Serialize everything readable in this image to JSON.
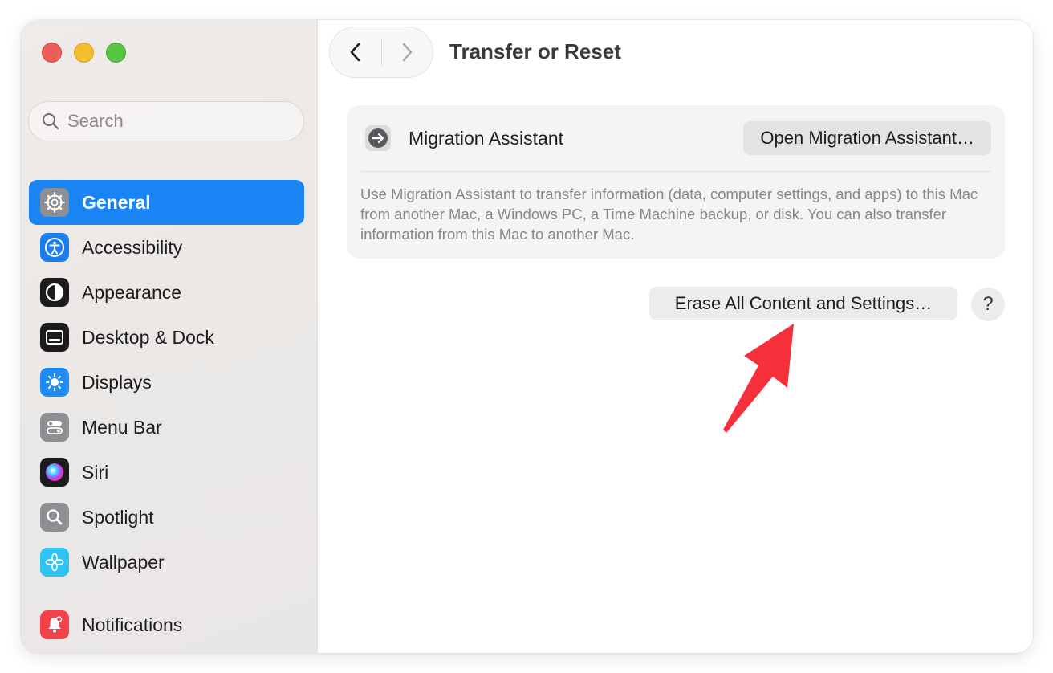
{
  "window": {
    "title": "Transfer or Reset"
  },
  "search": {
    "placeholder": "Search"
  },
  "sidebar": {
    "items": [
      {
        "label": "General",
        "icon": "gear-icon",
        "active": true
      },
      {
        "label": "Accessibility",
        "icon": "accessibility-icon"
      },
      {
        "label": "Appearance",
        "icon": "appearance-icon"
      },
      {
        "label": "Desktop & Dock",
        "icon": "dock-icon"
      },
      {
        "label": "Displays",
        "icon": "sun-icon"
      },
      {
        "label": "Menu Bar",
        "icon": "menu-bar-icon"
      },
      {
        "label": "Siri",
        "icon": "siri-icon"
      },
      {
        "label": "Spotlight",
        "icon": "magnifier-icon"
      },
      {
        "label": "Wallpaper",
        "icon": "flower-icon"
      },
      {
        "label": "Notifications",
        "icon": "bell-icon"
      }
    ]
  },
  "migration": {
    "label": "Migration Assistant",
    "button": "Open Migration Assistant…",
    "description": "Use Migration Assistant to transfer information (data, computer settings, and apps) to this Mac from another Mac, a Windows PC, a Time Machine backup, or disk. You can also transfer information from this Mac to another Mac."
  },
  "actions": {
    "erase_button": "Erase All Content and Settings…",
    "help_button": "?"
  },
  "colors": {
    "accent": "#1a84f5",
    "annotation_arrow": "#f5303a"
  }
}
